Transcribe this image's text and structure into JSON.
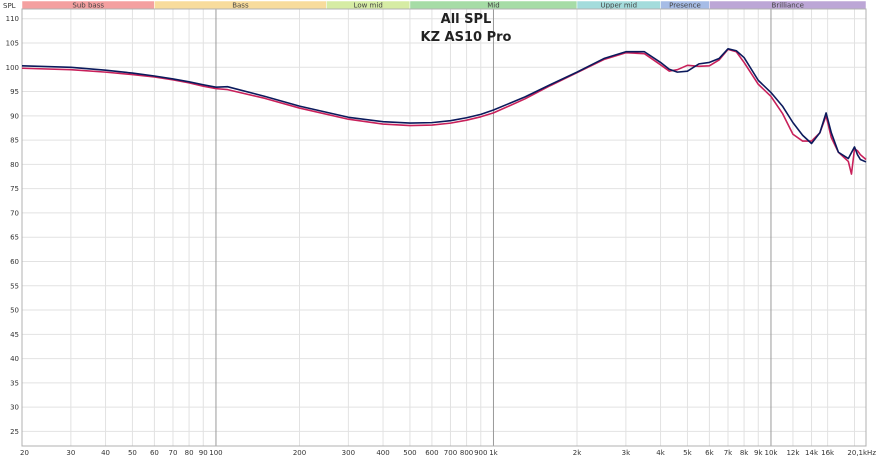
{
  "chart_data": {
    "type": "line",
    "title": "All SPL",
    "subtitle": "KZ AS10 Pro",
    "y_axis_label": "SPL",
    "x_scale": "log",
    "xlim": [
      20,
      22000
    ],
    "ylim": [
      22,
      112
    ],
    "grid": true,
    "x_ticks": [
      {
        "v": 20,
        "label": "20"
      },
      {
        "v": 30,
        "label": "30"
      },
      {
        "v": 40,
        "label": "40"
      },
      {
        "v": 50,
        "label": "50"
      },
      {
        "v": 60,
        "label": "60"
      },
      {
        "v": 70,
        "label": "70"
      },
      {
        "v": 80,
        "label": "80"
      },
      {
        "v": 90,
        "label": "90"
      },
      {
        "v": 100,
        "label": "100"
      },
      {
        "v": 200,
        "label": "200"
      },
      {
        "v": 300,
        "label": "300"
      },
      {
        "v": 400,
        "label": "400"
      },
      {
        "v": 500,
        "label": "500"
      },
      {
        "v": 600,
        "label": "600"
      },
      {
        "v": 700,
        "label": "700"
      },
      {
        "v": 800,
        "label": "800"
      },
      {
        "v": 900,
        "label": "900"
      },
      {
        "v": 1000,
        "label": "1k"
      },
      {
        "v": 2000,
        "label": "2k"
      },
      {
        "v": 3000,
        "label": "3k"
      },
      {
        "v": 4000,
        "label": "4k"
      },
      {
        "v": 5000,
        "label": "5k"
      },
      {
        "v": 6000,
        "label": "6k"
      },
      {
        "v": 7000,
        "label": "7k"
      },
      {
        "v": 8000,
        "label": "8k"
      },
      {
        "v": 9000,
        "label": "9k"
      },
      {
        "v": 10000,
        "label": "10k"
      },
      {
        "v": 12000,
        "label": "12k"
      },
      {
        "v": 14000,
        "label": "14k"
      },
      {
        "v": 16000,
        "label": "16k"
      },
      {
        "v": 20000,
        "label": "20,1kHz"
      }
    ],
    "y_ticks": [
      25,
      30,
      35,
      40,
      45,
      50,
      55,
      60,
      65,
      70,
      75,
      80,
      85,
      90,
      95,
      100,
      105,
      110
    ],
    "major_x_lines": [
      100,
      1000,
      10000
    ],
    "bands": [
      {
        "name": "Sub bass",
        "from": 20,
        "to": 60,
        "color": "#f4a0a0"
      },
      {
        "name": "Bass",
        "from": 60,
        "to": 250,
        "color": "#f8dc9c"
      },
      {
        "name": "Low mid",
        "from": 250,
        "to": 500,
        "color": "#d6eca4"
      },
      {
        "name": "Mid",
        "from": 500,
        "to": 2000,
        "color": "#a6dca6"
      },
      {
        "name": "Upper mid",
        "from": 2000,
        "to": 4000,
        "color": "#a4dcdc"
      },
      {
        "name": "Presence",
        "from": 4000,
        "to": 6000,
        "color": "#a6bce6"
      },
      {
        "name": "Brilliance",
        "from": 6000,
        "to": 22000,
        "color": "#bca6d6"
      }
    ],
    "series": [
      {
        "color": "#0b1a5c",
        "x": [
          20,
          30,
          40,
          50,
          60,
          70,
          80,
          90,
          100,
          110,
          150,
          200,
          300,
          400,
          500,
          600,
          700,
          800,
          900,
          1000,
          1300,
          1600,
          2000,
          2500,
          3000,
          3500,
          4000,
          4300,
          4600,
          5000,
          5500,
          6000,
          6500,
          7000,
          7500,
          8000,
          9000,
          10000,
          11000,
          12000,
          13000,
          14000,
          15000,
          15800,
          16500,
          17500,
          19000,
          20000,
          20500,
          21000,
          22000
        ],
        "y": [
          100.3,
          100.0,
          99.4,
          98.8,
          98.2,
          97.6,
          97.0,
          96.4,
          95.9,
          96.0,
          94.0,
          92.0,
          89.7,
          88.8,
          88.5,
          88.6,
          89.0,
          89.6,
          90.3,
          91.2,
          93.9,
          96.4,
          99.0,
          101.8,
          103.2,
          103.2,
          101.0,
          99.6,
          99.0,
          99.2,
          100.7,
          101.0,
          101.8,
          103.8,
          103.4,
          102.0,
          97.3,
          94.8,
          92.0,
          88.6,
          86.0,
          84.3,
          86.5,
          90.6,
          86.5,
          82.5,
          81.2,
          83.6,
          82.0,
          81.0,
          80.5
        ]
      },
      {
        "color": "#c8205a",
        "x": [
          20,
          30,
          40,
          50,
          60,
          70,
          80,
          90,
          100,
          110,
          150,
          200,
          300,
          400,
          500,
          600,
          700,
          800,
          900,
          1000,
          1300,
          1600,
          2000,
          2500,
          3000,
          3500,
          4000,
          4300,
          4600,
          5000,
          5500,
          6000,
          6500,
          7000,
          7500,
          8000,
          9000,
          10000,
          11000,
          12000,
          13000,
          14000,
          15000,
          15800,
          16500,
          17500,
          19000,
          19500,
          20000,
          20500,
          21000,
          22000
        ],
        "y": [
          99.8,
          99.5,
          99.0,
          98.5,
          98.0,
          97.4,
          96.8,
          96.1,
          95.6,
          95.4,
          93.6,
          91.6,
          89.3,
          88.3,
          88.0,
          88.1,
          88.5,
          89.1,
          89.8,
          90.6,
          93.5,
          96.2,
          98.9,
          101.6,
          103.0,
          102.8,
          100.5,
          99.2,
          99.5,
          100.4,
          100.2,
          100.3,
          101.5,
          103.7,
          103.2,
          101.0,
          96.5,
          94.0,
          90.5,
          86.2,
          84.8,
          84.8,
          86.5,
          90.0,
          85.5,
          82.5,
          80.6,
          78.0,
          83.2,
          82.8,
          82.0,
          81.0
        ]
      }
    ]
  }
}
